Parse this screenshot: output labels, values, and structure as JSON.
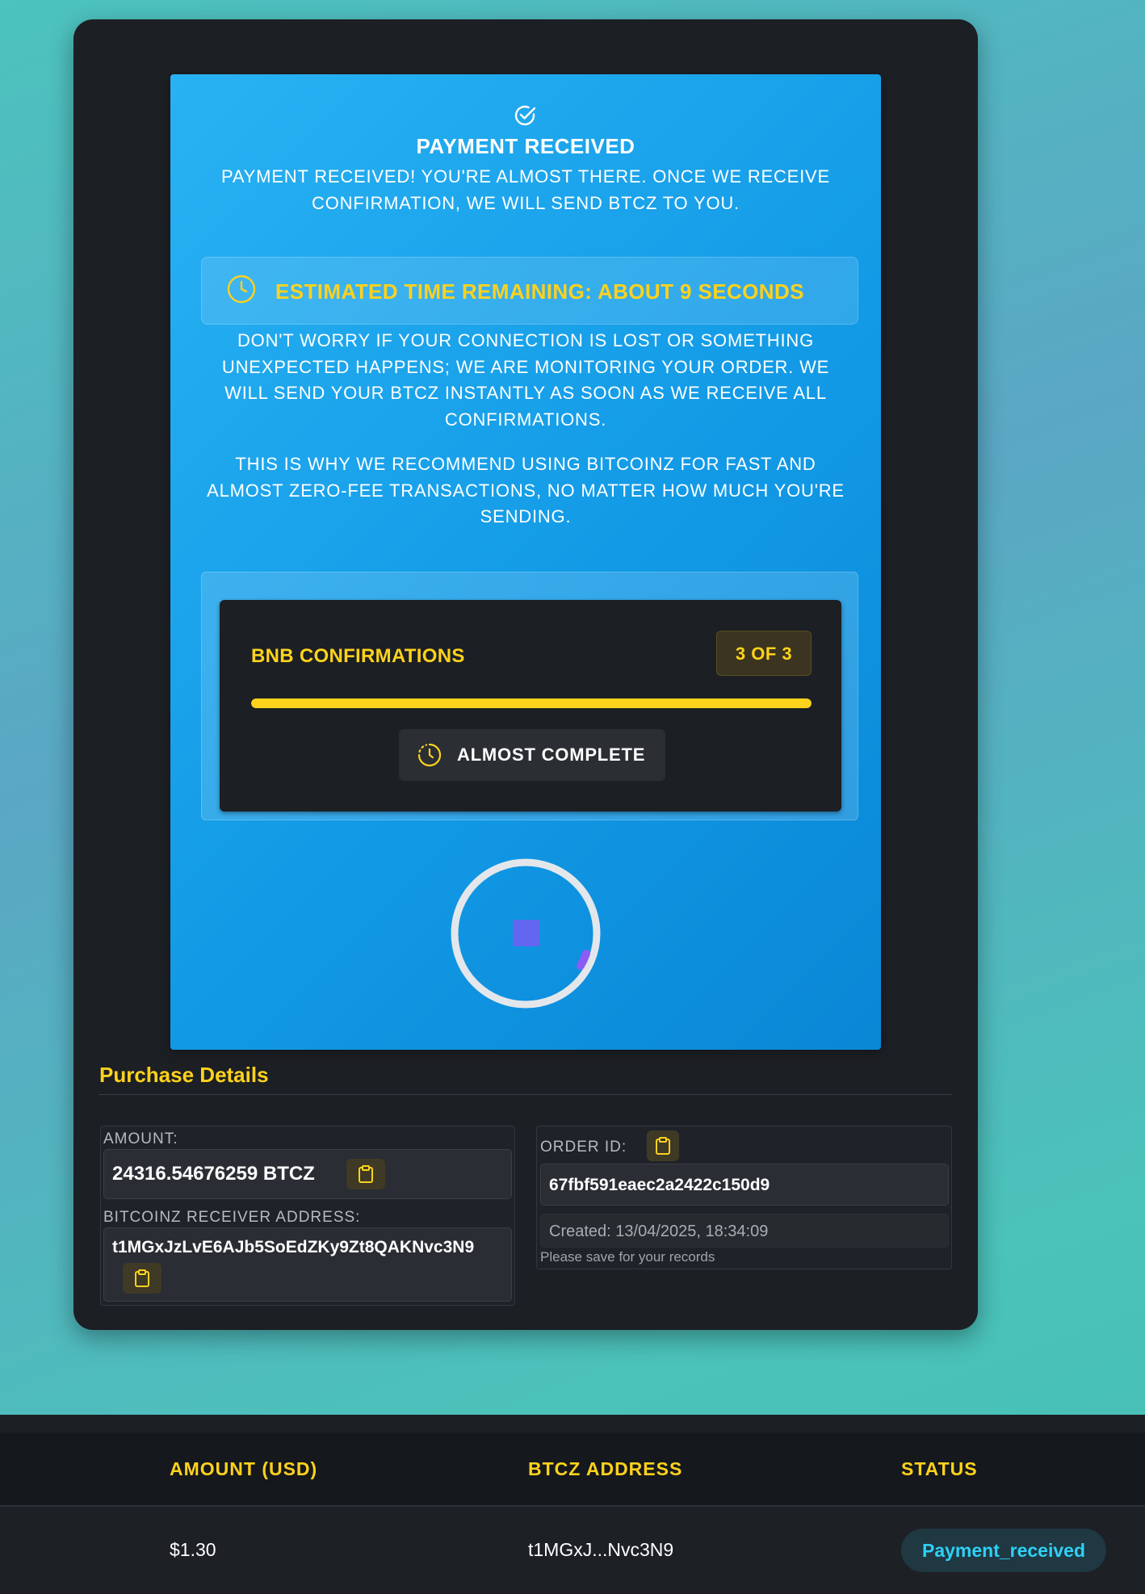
{
  "payment_panel": {
    "title": "PAYMENT RECEIVED",
    "message": "PAYMENT RECEIVED! YOU'RE ALMOST THERE. ONCE WE RECEIVE CONFIRMATION, WE WILL SEND BTCZ TO YOU.",
    "eta": "ESTIMATED TIME REMAINING: ABOUT 9 SECONDS",
    "reassurance": "DON'T WORRY IF YOUR CONNECTION IS LOST OR SOMETHING UNEXPECTED HAPPENS; WE ARE MONITORING YOUR ORDER. WE WILL SEND YOUR BTCZ INSTANTLY AS SOON AS WE RECEIVE ALL CONFIRMATIONS.",
    "recommendation": "THIS IS WHY WE RECOMMEND USING BITCOINZ FOR FAST AND ALMOST ZERO-FEE TRANSACTIONS, NO MATTER HOW MUCH YOU'RE SENDING.",
    "confirmations": {
      "label": "BNB CONFIRMATIONS",
      "count_text": "3 OF 3",
      "progress_fraction": 1.0,
      "status": "ALMOST COMPLETE"
    }
  },
  "purchase_details": {
    "title": "Purchase Details",
    "amount_label": "AMOUNT:",
    "amount_value": "24316.54676259 BTCZ",
    "address_label": "BITCOINZ RECEIVER ADDRESS:",
    "address_value": "t1MGxJzLvE6AJb5SoEdZKy9Zt8QAKNvc3N9",
    "order_label": "ORDER ID:",
    "order_value": "67fbf591eaec2a2422c150d9",
    "created": "Created: 13/04/2025, 18:34:09",
    "save_note": "Please save for your records"
  },
  "table": {
    "headers": [
      "AMOUNT (USD)",
      "BTCZ ADDRESS",
      "STATUS"
    ],
    "rows": [
      {
        "amount": "$1.30",
        "address": "t1MGxJ...Nvc3N9",
        "status": "Payment_received"
      }
    ]
  },
  "colors": {
    "accent_yellow": "#ffd21c",
    "panel_blue": "#129ae6",
    "status_cyan": "#2fd0f5",
    "spinner_purple": "#6366f1"
  }
}
